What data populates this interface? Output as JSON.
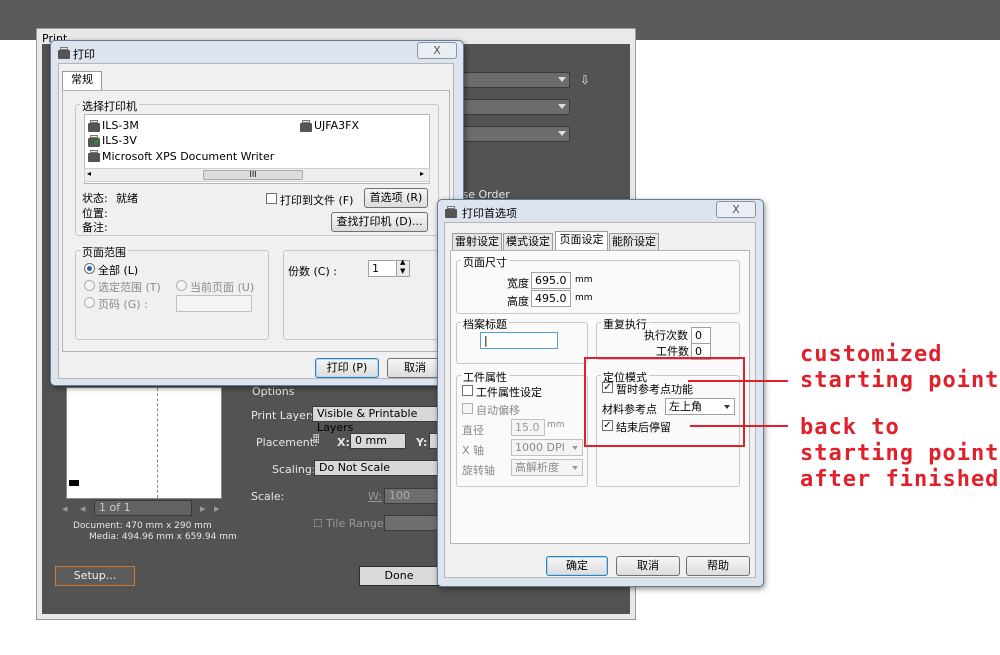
{
  "ai_dialog": {
    "title": "Print",
    "reverse_order": "rse Order",
    "options_header": "Options",
    "print_layers_label": "Print Layers:",
    "print_layers_value": "Visible & Printable Layers",
    "placement_label": "Placement:",
    "x_label": "X:",
    "x_value": "0 mm",
    "y_label": "Y:",
    "scaling_label": "Scaling:",
    "scaling_value": "Do Not Scale",
    "scale_label": "Scale:",
    "w_label": "W:",
    "w_value": "100",
    "tile_range_label": "Tile Range:",
    "page_nav": "1 of 1",
    "document_size": "Document: 470 mm x 290 mm",
    "media_size": "Media: 494.96 mm x 659.94 mm",
    "setup_button": "Setup...",
    "done_button": "Done"
  },
  "print_dialog": {
    "title": "打印",
    "close": "X",
    "tab": "常规",
    "select_printer_label": "选择打印机",
    "printers": [
      "ILS-3M",
      "UJFA3FX",
      "ILS-3V",
      "Microsoft XPS Document Writer"
    ],
    "scroll_thumb": "III",
    "status_label": "状态:",
    "status_value": "就绪",
    "location_label": "位置:",
    "comment_label": "备注:",
    "print_to_file": "打印到文件 (F)",
    "preferences_button": "首选项 (R)",
    "find_printer_button": "查找打印机 (D)...",
    "page_range_label": "页面范围",
    "all": "全部 (L)",
    "selection": "选定范围 (T)",
    "current_page": "当前页面 (U)",
    "pages": "页码 (G) :",
    "copies_label": "份数 (C) :",
    "copies_value": "1",
    "print_button": "打印 (P)",
    "cancel_button": "取消"
  },
  "pref_dialog": {
    "title": "打印首选项",
    "close": "X",
    "tabs": [
      "雷射设定",
      "模式设定",
      "页面设定",
      "能阶设定"
    ],
    "page_size_label": "页面尺寸",
    "width_label": "宽度",
    "width_value": "695.0",
    "height_label": "高度",
    "height_value": "495.0",
    "unit_mm": "mm",
    "file_title_label": "档案标题",
    "repeat_label": "重复执行",
    "exec_count_label": "执行次数",
    "exec_count_value": "0",
    "piece_count_label": "工件数",
    "piece_count_value": "0",
    "work_attr_label": "工件属性",
    "work_attr_setting": "工件属性设定",
    "auto_offset": "自动偏移",
    "diameter_label": "直径",
    "diameter_value": "15.0",
    "x_axis_label": "X 轴",
    "x_axis_value": "1000 DPI",
    "rotation_label": "旋转轴",
    "rotation_value": "高解析度",
    "position_mode_label": "定位模式",
    "temp_ref": "暂时参考点功能",
    "material_ref_label": "材料参考点",
    "material_ref_value": "左上角",
    "stop_after": "结束后停留",
    "ok_button": "确定",
    "cancel_button": "取消",
    "help_button": "帮助"
  },
  "annotations": {
    "custom_line1": "customized",
    "custom_line2": "starting point",
    "back_line1": "back to",
    "back_line2": "starting point",
    "back_line3": "after finished",
    "color": "#e0212b"
  }
}
